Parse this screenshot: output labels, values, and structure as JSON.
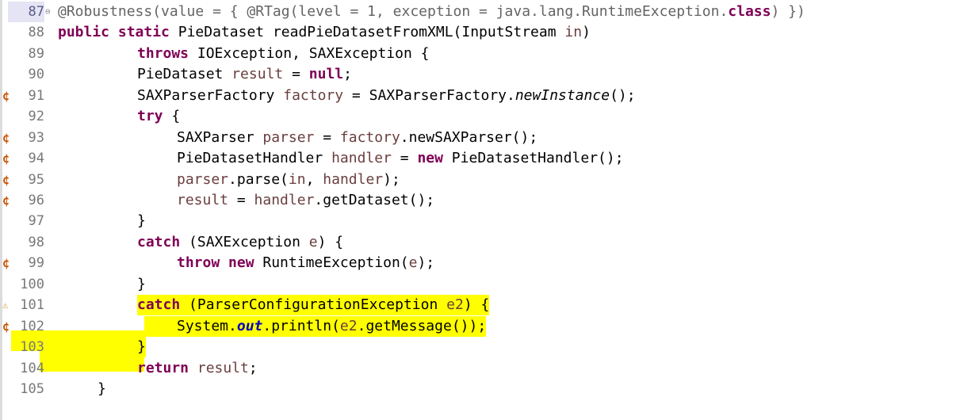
{
  "editor": {
    "highlight_color": "#ffff00",
    "syntax_colors": {
      "keyword": "#7f0055",
      "annotation": "#646464",
      "local_variable": "#6a3e3e",
      "static_field": "#0000c0"
    },
    "lines": [
      {
        "number": "87",
        "marker": "",
        "fold": "⊖",
        "code": [
          "@Robustness(value = { @RTag(level = 1, exception = java.lang.RuntimeException.",
          "class",
          ") })"
        ]
      },
      {
        "number": "88",
        "marker": "",
        "code": [
          "public",
          " ",
          "static",
          " PieDataset readPieDatasetFromXML(InputStream ",
          "in",
          ")"
        ]
      },
      {
        "number": "89",
        "marker": "",
        "code": [
          "throws",
          " IOException, SAXException {"
        ]
      },
      {
        "number": "90",
        "marker": "",
        "code": [
          "PieDataset ",
          "result",
          " = ",
          "null",
          ";"
        ]
      },
      {
        "number": "91",
        "marker": "¢",
        "code": [
          "SAXParserFactory ",
          "factory",
          " = SAXParserFactory.",
          "newInstance",
          "();"
        ]
      },
      {
        "number": "92",
        "marker": "",
        "code": [
          "try",
          " {"
        ]
      },
      {
        "number": "93",
        "marker": "¢",
        "code": [
          "SAXParser ",
          "parser",
          " = ",
          "factory",
          ".newSAXParser();"
        ]
      },
      {
        "number": "94",
        "marker": "¢",
        "code": [
          "PieDatasetHandler ",
          "handler",
          " = ",
          "new",
          " PieDatasetHandler();"
        ]
      },
      {
        "number": "95",
        "marker": "¢",
        "code": [
          "parser",
          ".parse(",
          "in",
          ", ",
          "handler",
          ");"
        ]
      },
      {
        "number": "96",
        "marker": "¢",
        "code": [
          "result",
          " = ",
          "handler",
          ".getDataset();"
        ]
      },
      {
        "number": "97",
        "marker": "",
        "code": [
          "}"
        ]
      },
      {
        "number": "98",
        "marker": "",
        "code": [
          "catch",
          " (SAXException ",
          "e",
          ") {"
        ]
      },
      {
        "number": "99",
        "marker": "¢",
        "code": [
          "throw",
          " ",
          "new",
          " RuntimeException(",
          "e",
          ");"
        ]
      },
      {
        "number": "100",
        "marker": "",
        "code": [
          "}"
        ]
      },
      {
        "number": "101",
        "marker": "⚠",
        "code": [
          "catch",
          " (ParserConfigurationException ",
          "e2",
          ") {"
        ]
      },
      {
        "number": "102",
        "marker": "¢",
        "code": [
          "System.",
          "out",
          ".println(",
          "e2",
          ".getMessage());"
        ]
      },
      {
        "number": "103",
        "marker": "",
        "code": [
          "}"
        ]
      },
      {
        "number": "104",
        "marker": "",
        "code": [
          "return",
          " ",
          "result",
          ";"
        ]
      },
      {
        "number": "105",
        "marker": "",
        "code": [
          "}"
        ]
      }
    ]
  }
}
